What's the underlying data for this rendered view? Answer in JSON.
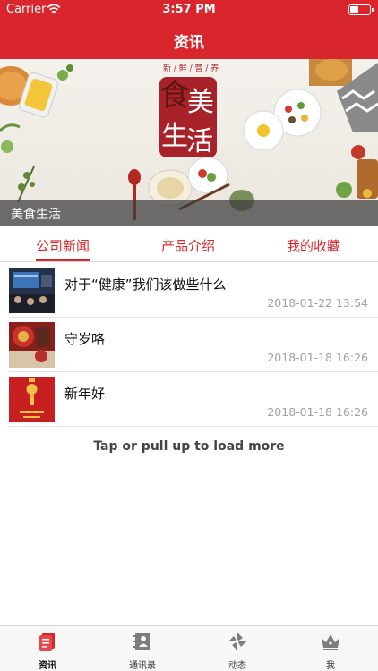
{
  "status_bar": {
    "carrier": "Carrier",
    "time": "3:57 PM"
  },
  "nav": {
    "title": "资讯"
  },
  "banner": {
    "caption": "美食生活",
    "artwork_text": {
      "small": "新鲜营养",
      "big": [
        "食",
        "美",
        "生",
        "活"
      ]
    }
  },
  "segments": [
    {
      "label": "公司新闻",
      "active": true
    },
    {
      "label": "产品介绍",
      "active": false
    },
    {
      "label": "我的收藏",
      "active": false
    }
  ],
  "news": [
    {
      "title": "对于“健康”我们该做些什么",
      "date": "2018-01-22 13:54",
      "thumb": "meeting-photo"
    },
    {
      "title": "守岁咯",
      "date": "2018-01-18 16:26",
      "thumb": "new-year-decoration-photo"
    },
    {
      "title": "新年好",
      "date": "2018-01-18 16:26",
      "thumb": "red-greeting-card-photo"
    }
  ],
  "load_more": "Tap or pull up to load more",
  "tabbar": [
    {
      "label": "资讯",
      "icon": "news-icon",
      "active": true
    },
    {
      "label": "通讯录",
      "icon": "contacts-icon",
      "active": false
    },
    {
      "label": "动态",
      "icon": "pinwheel-icon",
      "active": false
    },
    {
      "label": "我",
      "icon": "crown-icon",
      "active": false
    }
  ],
  "colors": {
    "brand_red": "#d9262c",
    "date_gray": "#a0a0a0",
    "tab_bg": "#f7f7f7"
  }
}
